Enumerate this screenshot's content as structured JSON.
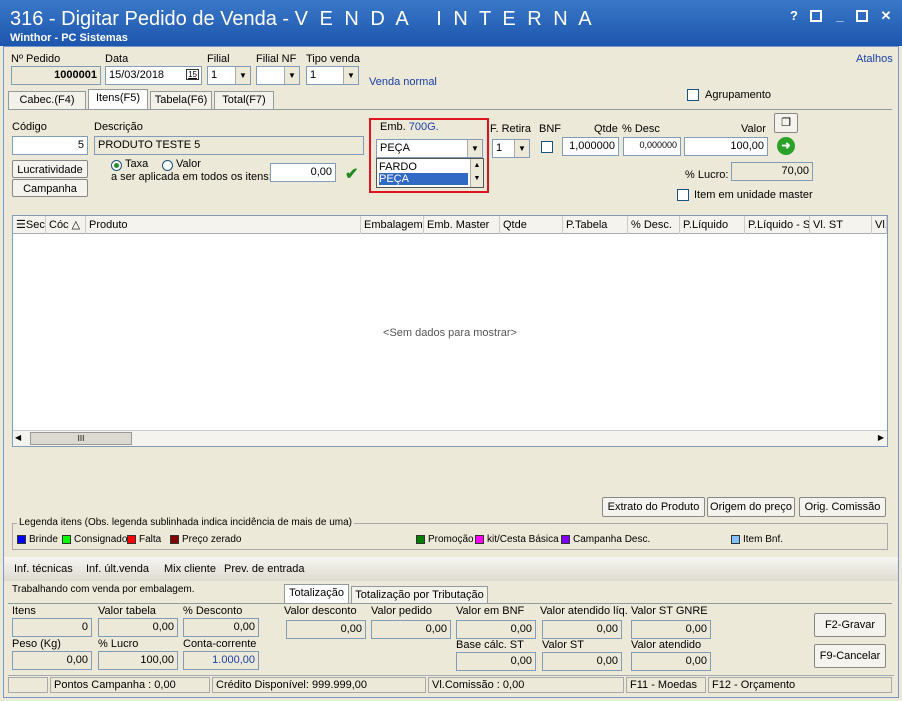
{
  "window": {
    "title_prefix": "316 - Digitar Pedido de Venda - ",
    "title_mode": "V E N D A   I N T E R N A",
    "subtitle": "Winthor - PC Sistemas",
    "atalhos": "Atalhos",
    "help": "?",
    "minimize": "_",
    "restore": "▫",
    "close": "✕"
  },
  "header": {
    "pedido_label": "Nº Pedido",
    "pedido_value": "1000001",
    "data_label": "Data",
    "data_value": "15/03/2018",
    "cal_icon": "15",
    "filial_label": "Filial",
    "filial_value": "1",
    "filialnf_label": "Filial NF",
    "filialnf_value": "",
    "tipovenda_label": "Tipo venda",
    "tipovenda_value": "1",
    "venda_normal": "Venda normal"
  },
  "tabs": [
    {
      "label": "Cabec.(F4)"
    },
    {
      "label": "Itens(F5)"
    },
    {
      "label": "Tabela(F6)"
    },
    {
      "label": "Total(F7)"
    }
  ],
  "item": {
    "codigo_label": "Código",
    "codigo_value": "5",
    "descricao_label": "Descrição",
    "descricao_value": "PRODUTO TESTE 5",
    "emb_label": "Emb.",
    "emb_value": "700G.",
    "emb_selected": "PEÇA",
    "emb_options": [
      "FARDO",
      "PEÇA"
    ],
    "fretira_label": "F. Retira",
    "fretira_value": "1",
    "bnf_label": "BNF",
    "qtde_label": "Qtde",
    "qtde_value": "1,000000",
    "desc_label": "% Desc",
    "desc_value": "0,000000",
    "valor_label": "Valor",
    "valor_value": "100,00",
    "agrupamento_label": "Agrupamento",
    "lucro_label": "% Lucro:",
    "lucro_value": "70,00",
    "item_master_label": "Item em unidade master",
    "lucratividade_btn": "Lucratividade",
    "campanha_btn": "Campanha",
    "taxa_label": "Taxa",
    "valor_radio_label": "Valor",
    "aplicada_label": "a ser aplicada em todos os itens:",
    "aplicada_value": "0,00"
  },
  "grid": {
    "columns": [
      "Sec",
      "Cóc",
      "Produto",
      "Embalagem",
      "Emb. Master",
      "Qtde",
      "P.Tabela",
      "% Desc.",
      "P.Líquido",
      "P.Líquido - S",
      "Vl. ST",
      "Vl."
    ],
    "empty": "<Sem dados para mostrar>",
    "scroll_thumb": "III"
  },
  "actions": {
    "extrato": "Extrato do Produto",
    "origem": "Origem do preço",
    "comissao": "Orig. Comissão"
  },
  "legend": {
    "title": "Legenda itens (Obs. legenda sublinhada indica incidência de mais de uma)",
    "items": [
      {
        "label": "Brinde",
        "color": "#0000ff"
      },
      {
        "label": "Consignado",
        "color": "#00ff00"
      },
      {
        "label": "Falta",
        "color": "#ff0000"
      },
      {
        "label": "Preço zerado",
        "color": "#800000"
      },
      {
        "label": "Promoção",
        "color": "#008000"
      },
      {
        "label": "kit/Cesta Básica",
        "color": "#ff00ff"
      },
      {
        "label": "Campanha Desc.",
        "color": "#8000ff"
      },
      {
        "label": "Item Bnf.",
        "color": "#80c0ff"
      }
    ]
  },
  "links": [
    "Inf. técnicas",
    "Inf. últ.venda",
    "Mix cliente",
    "Prev. de entrada"
  ],
  "bottom": {
    "trabalhando": "Trabalhando com venda por embalagem.",
    "tabs": [
      "Totalização",
      "Totalização por Tributação"
    ],
    "itens_label": "Itens",
    "itens_value": "0",
    "valortabela_label": "Valor tabela",
    "valortabela_value": "0,00",
    "pdesconto_label": "% Desconto",
    "pdesconto_value": "0,00",
    "peso_label": "Peso (Kg)",
    "peso_value": "0,00",
    "plucro_label": "% Lucro",
    "plucro_value": "100,00",
    "cc_label": "Conta-corrente",
    "cc_value": "1.000,00",
    "valordesconto_label": "Valor desconto",
    "valordesconto_value": "0,00",
    "valorpedido_label": "Valor pedido",
    "valorpedido_value": "0,00",
    "valorbnf_label": "Valor em BNF",
    "valorbnf_value": "0,00",
    "valoratliq_label": "Valor atendido líq.",
    "valoratliq_value": "0,00",
    "valorstgnre_label": "Valor ST GNRE",
    "valorstgnre_value": "0,00",
    "basest_label": "Base cálc. ST",
    "basest_value": "0,00",
    "valorst_label": "Valor ST",
    "valorst_value": "0,00",
    "valorat_label": "Valor atendido",
    "valorat_value": "0,00",
    "gravar_btn": "F2-Gravar",
    "cancelar_btn": "F9-Cancelar"
  },
  "status": {
    "pontos": "Pontos Campanha : 0,00",
    "credito": "Crédito Disponível: 999.999,00",
    "comissao": "Vl.Comissão : 0,00",
    "moedas": "F11 - Moedas",
    "orcamento": "F12 - Orçamento"
  }
}
